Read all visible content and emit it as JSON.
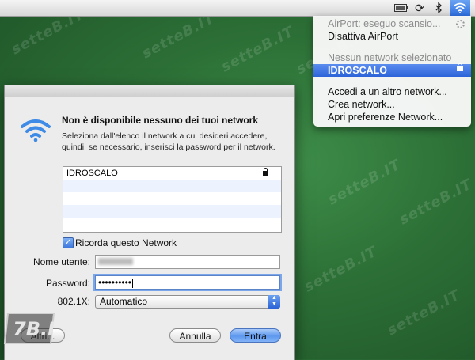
{
  "background": {
    "watermark_text": "setteB.IT",
    "color": "#2c6f36"
  },
  "menubar": {
    "icons": [
      "battery-icon",
      "sync-icon",
      "bluetooth-icon",
      "wifi-icon"
    ]
  },
  "airport_menu": {
    "status": "AirPort: eseguo scansio...",
    "toggle": "Disattiva AirPort",
    "no_network": "Nessun network selezionato",
    "selected_network": "IDROSCALO",
    "other_network": "Accedi a un altro network...",
    "create_network": "Crea network...",
    "open_prefs": "Apri preferenze Network..."
  },
  "dialog": {
    "title": "Non è disponibile nessuno dei tuoi network",
    "description": "Seleziona dall'elenco il network a cui desideri accedere, quindi, se necessario, inserisci la password per il network.",
    "networks": [
      {
        "name": "IDROSCALO",
        "locked": true
      }
    ],
    "remember_label": "Ricorda questo Network",
    "remember_checked": true,
    "username_label": "Nome utente:",
    "password_label": "Password:",
    "password_value": "••••••••••",
    "auth_label": "802.1X:",
    "auth_value": "Automatico",
    "other_button": "Altri...",
    "cancel_button": "Annulla",
    "join_button": "Entra",
    "accent": "#3d78dd"
  },
  "badge": {
    "text": "7B.I"
  }
}
